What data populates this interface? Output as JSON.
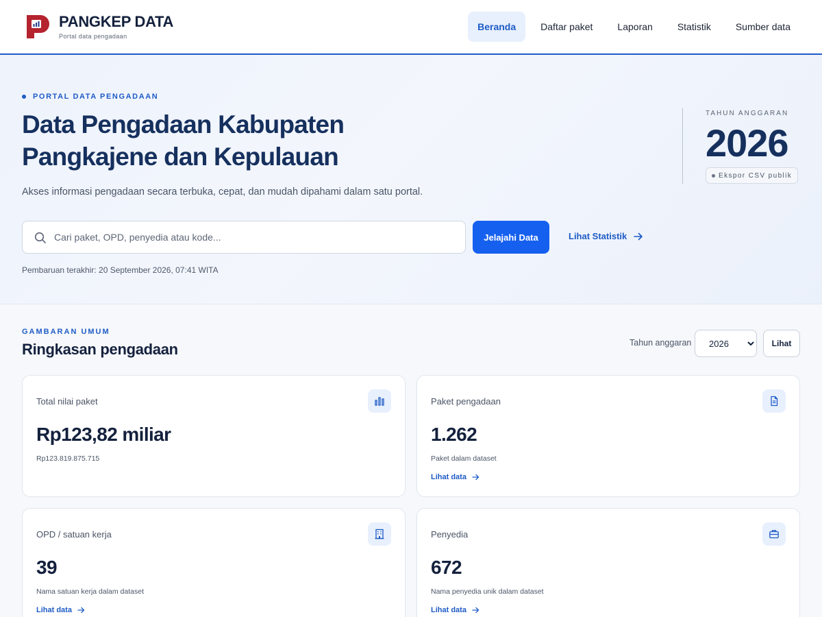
{
  "header": {
    "brand_name": "PANGKEP DATA",
    "brand_sub": "Portal data pengadaan",
    "nav": [
      {
        "label": "Beranda",
        "active": true
      },
      {
        "label": "Daftar paket"
      },
      {
        "label": "Laporan"
      },
      {
        "label": "Statistik"
      },
      {
        "label": "Sumber data"
      }
    ]
  },
  "hero": {
    "eyebrow": "PORTAL DATA PENGADAAN",
    "title_line1": "Data Pengadaan Kabupaten",
    "title_line2": "Pangkajene dan Kepulauan",
    "description": "Akses informasi pengadaan secara terbuka, cepat, dan mudah dipahami dalam satu portal.",
    "search_placeholder": "Cari paket, OPD, penyedia atau kode...",
    "search_value": "",
    "primary_button": "Jelajahi Data",
    "stat_link": "Lihat Statistik",
    "updated": "Pembaruan terakhir: 20 September 2026, 07:41 WITA",
    "year_label": "TAHUN ANGGARAN",
    "year_value": "2026",
    "year_badge": "Ekspor CSV publik"
  },
  "summary": {
    "eyebrow": "GAMBARAN UMUM",
    "title": "Ringkasan pengadaan",
    "filter_label": "Tahun anggaran",
    "filter_value": "2026",
    "filter_button": "Lihat",
    "cards": [
      {
        "label": "Total nilai paket",
        "value": "Rp123,82 miliar",
        "sub": "Rp123.819.875.715",
        "icon": "bar-chart-icon"
      },
      {
        "label": "Paket pengadaan",
        "value": "1.262",
        "sub": "Paket dalam dataset",
        "link": "Lihat data",
        "icon": "document-icon"
      },
      {
        "label": "OPD / satuan kerja",
        "value": "39",
        "sub": "Nama satuan kerja dalam dataset",
        "link": "Lihat data",
        "icon": "building-icon"
      },
      {
        "label": "Penyedia",
        "value": "672",
        "sub": "Nama penyedia unik dalam dataset",
        "link": "Lihat data",
        "icon": "briefcase-icon"
      }
    ]
  },
  "colors": {
    "accent": "#1e5bc6",
    "primary_button": "#1660f0",
    "heading": "#16305e",
    "logo_red": "#b4232e"
  }
}
